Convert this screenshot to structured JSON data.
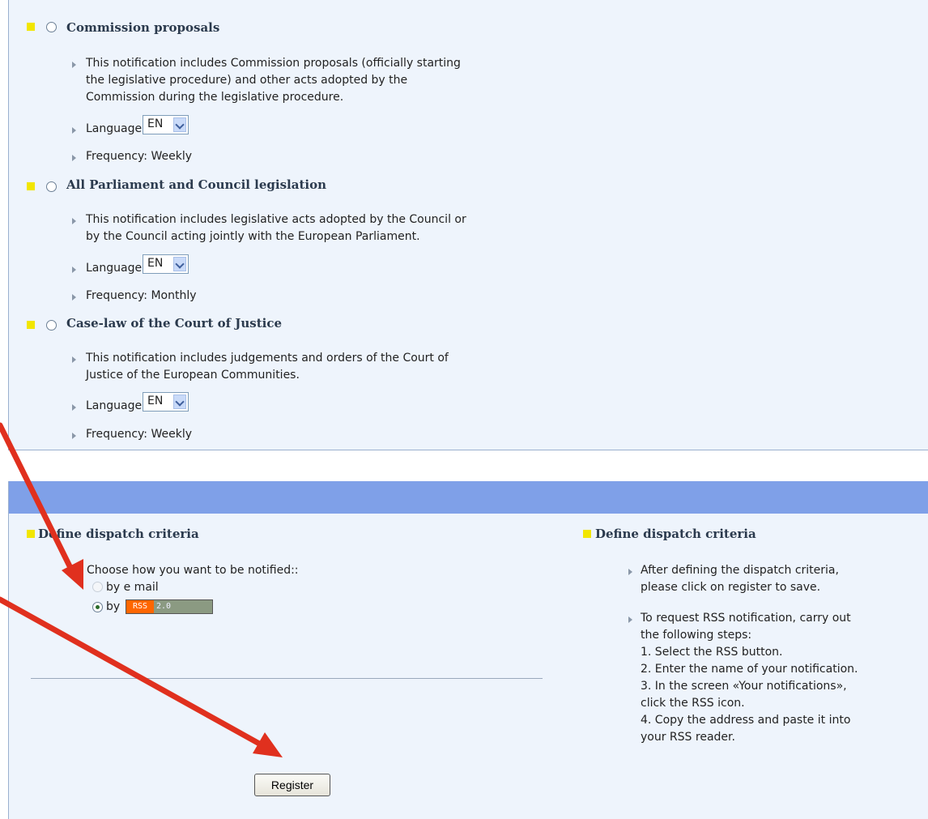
{
  "notifications": [
    {
      "title": "Commission proposals",
      "description": [
        "This notification includes Commission proposals (officially starting",
        "the legislative procedure) and other acts adopted by the",
        "Commission during the legislative procedure."
      ],
      "language_label": "Language:",
      "language_value": "EN",
      "frequency": "Frequency: Weekly"
    },
    {
      "title": "All Parliament and Council legislation",
      "description": [
        "This notification includes legislative acts adopted by the Council or",
        "by the Council acting jointly with the European Parliament."
      ],
      "language_label": "Language:",
      "language_value": "EN",
      "frequency": "Frequency: Monthly"
    },
    {
      "title": "Case-law of the Court of Justice",
      "description": [
        "This notification includes judgements and orders of the Court of",
        "Justice of the European Communities."
      ],
      "language_label": "Language:",
      "language_value": "EN",
      "frequency": "Frequency: Weekly"
    }
  ],
  "dispatch": {
    "left_heading": "Define dispatch criteria",
    "choose_label": "Choose how you want to be notified::",
    "option_email": "by e mail",
    "option_rss_prefix": "by",
    "rss_badge_left": "RSS",
    "rss_badge_right": "2.0",
    "register_label": "Register",
    "right_heading": "Define dispatch criteria",
    "help1": [
      "After defining the dispatch criteria,",
      "please click on register to save."
    ],
    "help2": [
      "To request RSS notification, carry out",
      "the following steps:",
      "1. Select the RSS button.",
      "2. Enter the name of your notification.",
      "3. In the screen «Your notifications»,",
      "click the RSS icon.",
      "4. Copy the address and paste it into",
      "your RSS reader."
    ]
  },
  "colors": {
    "panel_bg": "#eef4fc",
    "blue_bar": "#7fa0e8",
    "yellow_square": "#f2e600",
    "arrow_red": "#e0301e"
  }
}
